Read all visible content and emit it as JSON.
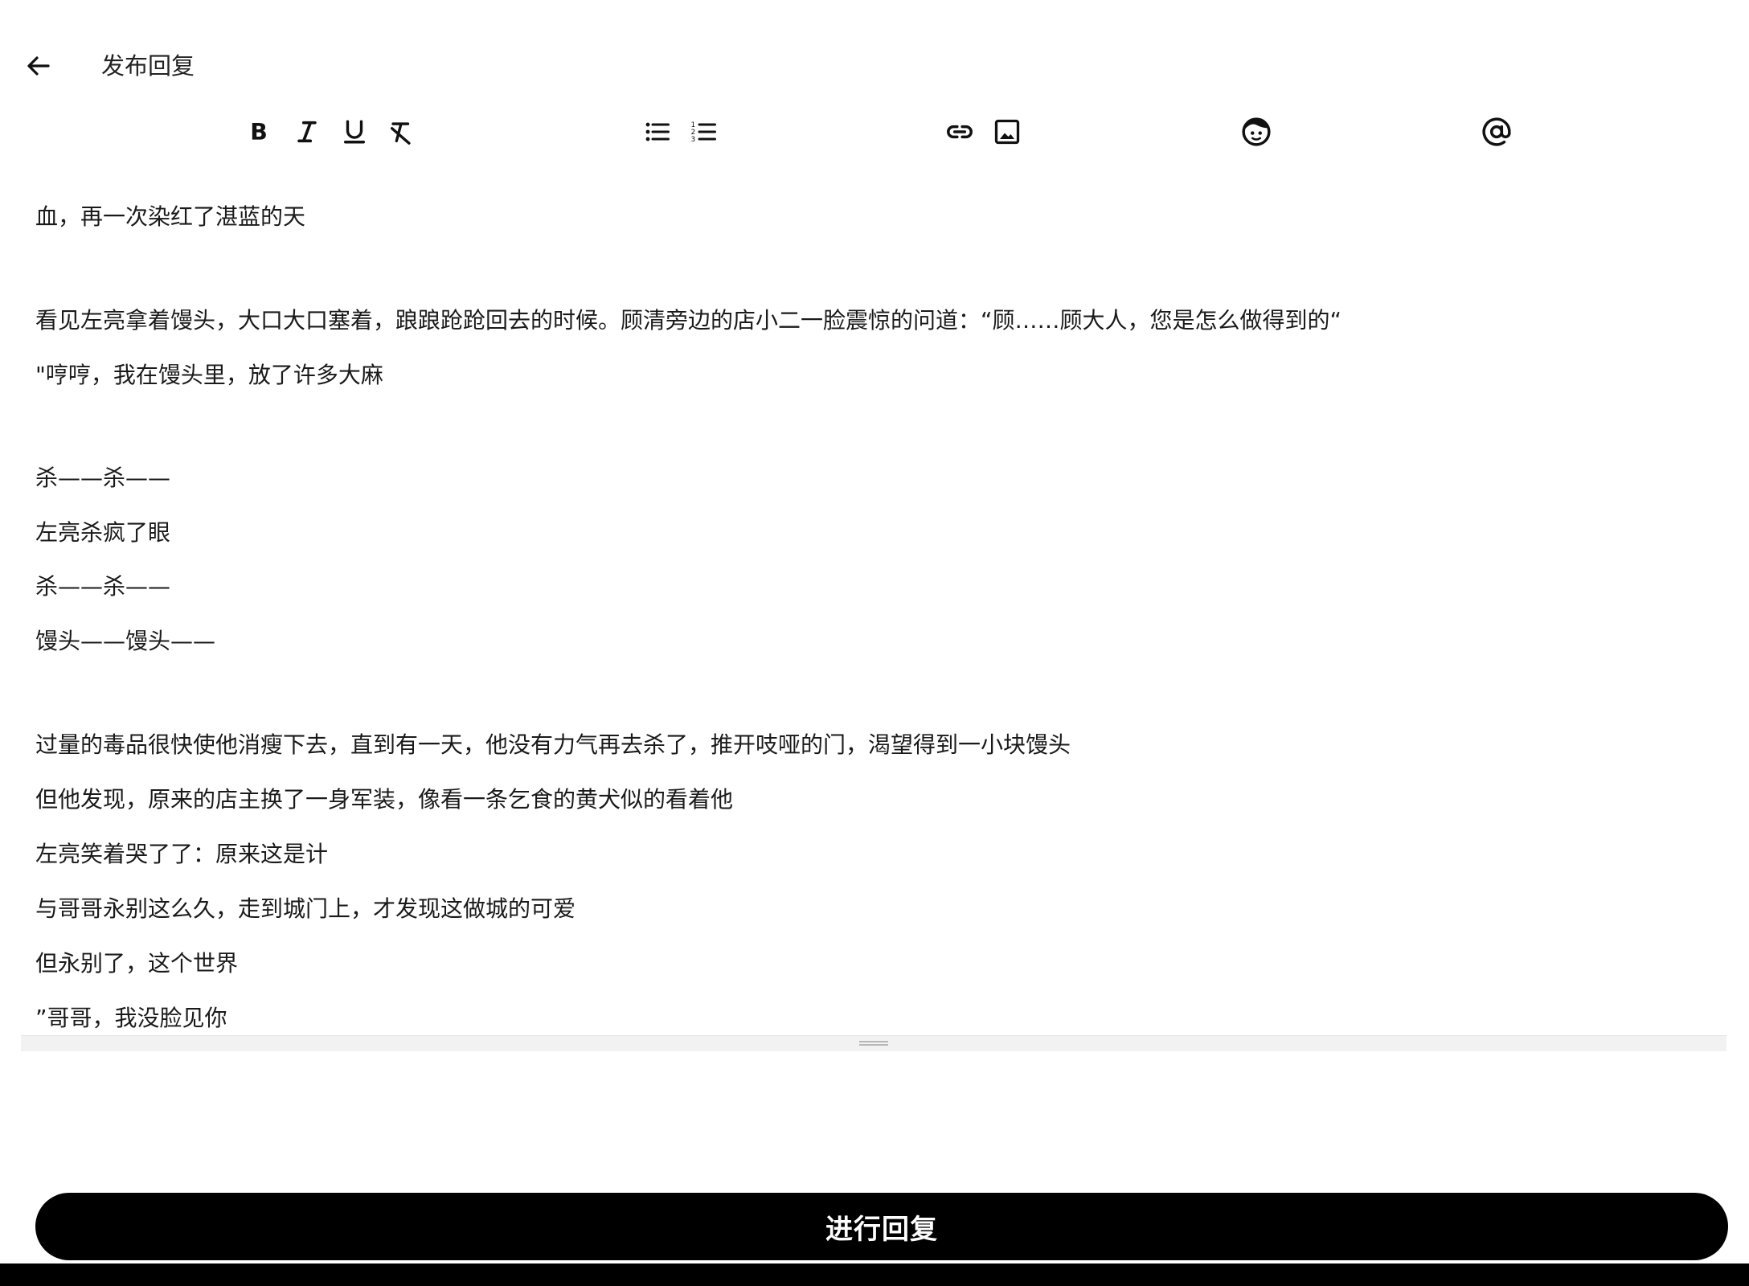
{
  "header": {
    "back_icon": "arrow-left-icon",
    "title": "发布回复"
  },
  "toolbar": {
    "items": [
      {
        "name": "bold",
        "icon": "bold-icon"
      },
      {
        "name": "italic",
        "icon": "italic-icon"
      },
      {
        "name": "underline",
        "icon": "underline-icon"
      },
      {
        "name": "clear-format",
        "icon": "clear-format-icon"
      },
      {
        "name": "bullet-list",
        "icon": "bullet-list-icon"
      },
      {
        "name": "numbered-list",
        "icon": "numbered-list-icon"
      },
      {
        "name": "link",
        "icon": "link-icon"
      },
      {
        "name": "image",
        "icon": "image-icon"
      },
      {
        "name": "emoji",
        "icon": "emoji-icon"
      },
      {
        "name": "mention",
        "icon": "at-icon"
      }
    ]
  },
  "editor": {
    "lines": [
      "血，再一次染红了湛蓝的天",
      "看见左亮拿着馒头，大口大口塞着，踉踉跄跄回去的时候。顾清旁边的店小二一脸震惊的问道：“顾……顾大人，您是怎么做得到的“",
      "\"哼哼，我在馒头里，放了许多大麻",
      "杀——杀——",
      "左亮杀疯了眼",
      "杀——杀——",
      "馒头——馒头——",
      "过量的毒品很快使他消瘦下去，直到有一天，他没有力气再去杀了，推开吱哑的门，渴望得到一小块馒头",
      "但他发现，原来的店主换了一身军装，像看一条乞食的黄犬似的看着他",
      "左亮笑着哭了了：原来这是计",
      "与哥哥永别这么久，走到城门上，才发现这做城的可爱",
      "但永别了，这个世界",
      "”哥哥，我没脸见你"
    ]
  },
  "submit": {
    "label": "进行回复"
  },
  "colors": {
    "background": "#ffffff",
    "button": "#000000",
    "button_text": "#ffffff",
    "resize_bar": "#f2f2f2"
  }
}
